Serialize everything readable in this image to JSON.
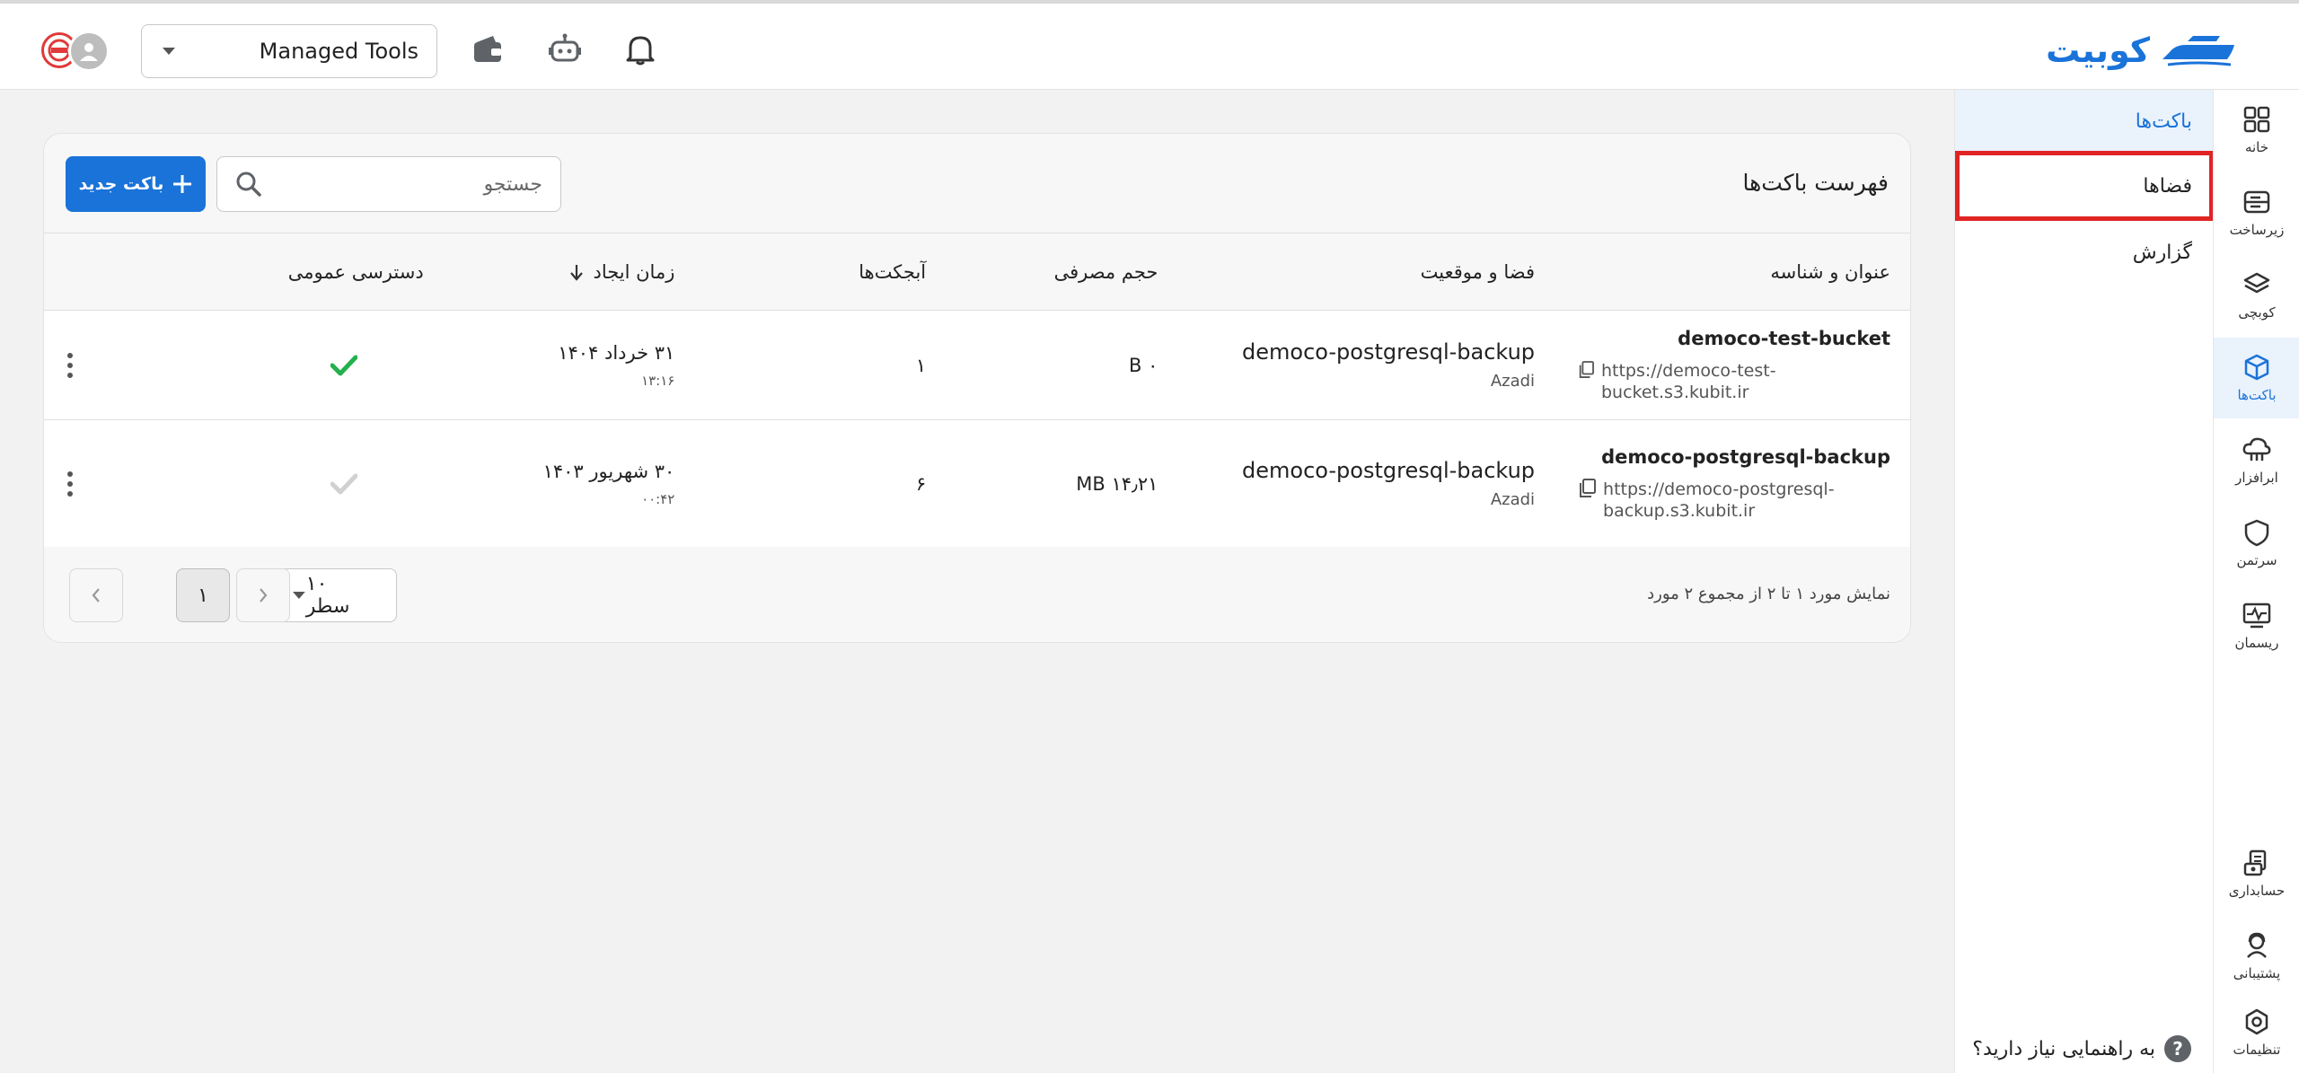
{
  "header": {
    "logo_text": "کوبیت",
    "tools_select": "Managed Tools",
    "icons": [
      "wallet-icon",
      "bot-icon",
      "bell-icon"
    ]
  },
  "rail": {
    "items": [
      {
        "label": "خانه",
        "icon": "grid-icon"
      },
      {
        "label": "زیرساخت",
        "icon": "server-icon"
      },
      {
        "label": "کوبچی",
        "icon": "layers-icon"
      },
      {
        "label": "باکت‌ها",
        "icon": "cube-icon",
        "active": true
      },
      {
        "label": "ابرافزار",
        "icon": "cloud-icon"
      },
      {
        "label": "سرتمن",
        "icon": "shield-icon"
      },
      {
        "label": "ریسمان",
        "icon": "monitor-icon"
      }
    ],
    "bottom_items": [
      {
        "label": "حسابداری",
        "icon": "accounting-icon"
      },
      {
        "label": "پشتیبانی",
        "icon": "support-icon"
      },
      {
        "label": "تنظیمات",
        "icon": "settings-icon"
      }
    ]
  },
  "subnav": {
    "items": [
      "باکت‌ها",
      "فضاها",
      "گزارش"
    ],
    "active_index": 0,
    "highlighted_index": 1,
    "help_text": "به راهنمایی نیاز دارید؟",
    "help_mark": "?"
  },
  "card": {
    "title": "فهرست باکت‌ها",
    "new_button": "باکت جدید",
    "search_placeholder": "جستجو"
  },
  "table": {
    "columns": [
      "عنوان و شناسه",
      "فضا و موقعیت",
      "حجم مصرفی",
      "آبجکت‌ها",
      "زمان ایجاد",
      "دسترسی عمومی"
    ],
    "rows": [
      {
        "name": "democo-test-bucket",
        "url": "https://democo-test-bucket.s3.kubit.ir",
        "space": "democo-postgresql-backup",
        "region": "Azadi",
        "size": "۰ B",
        "objects": "۱",
        "date": "۳۱ خرداد ۱۴۰۴",
        "time": "۱۳:۱۶",
        "public": true
      },
      {
        "name": "democo-postgresql-backup",
        "url_line1": "https://democo-postgresql-",
        "url_line2": "backup.s3.kubit.ir",
        "space": "democo-postgresql-backup",
        "region": "Azadi",
        "size": "۱۴٫۲۱ MB",
        "objects": "۶",
        "date": "۳۰ شهریور ۱۴۰۳",
        "time": "۰۰:۴۲",
        "public": false
      }
    ]
  },
  "pagination": {
    "summary": "نمایش مورد ۱ تا ۲ از مجموع ۲ مورد",
    "rows_per_page": "۱۰ سطر",
    "current_page": "۱"
  },
  "colors": {
    "accent": "#1a73d9",
    "check_active": "#22b14c",
    "check_inactive": "#d0d0d0",
    "highlight": "#e02424"
  }
}
